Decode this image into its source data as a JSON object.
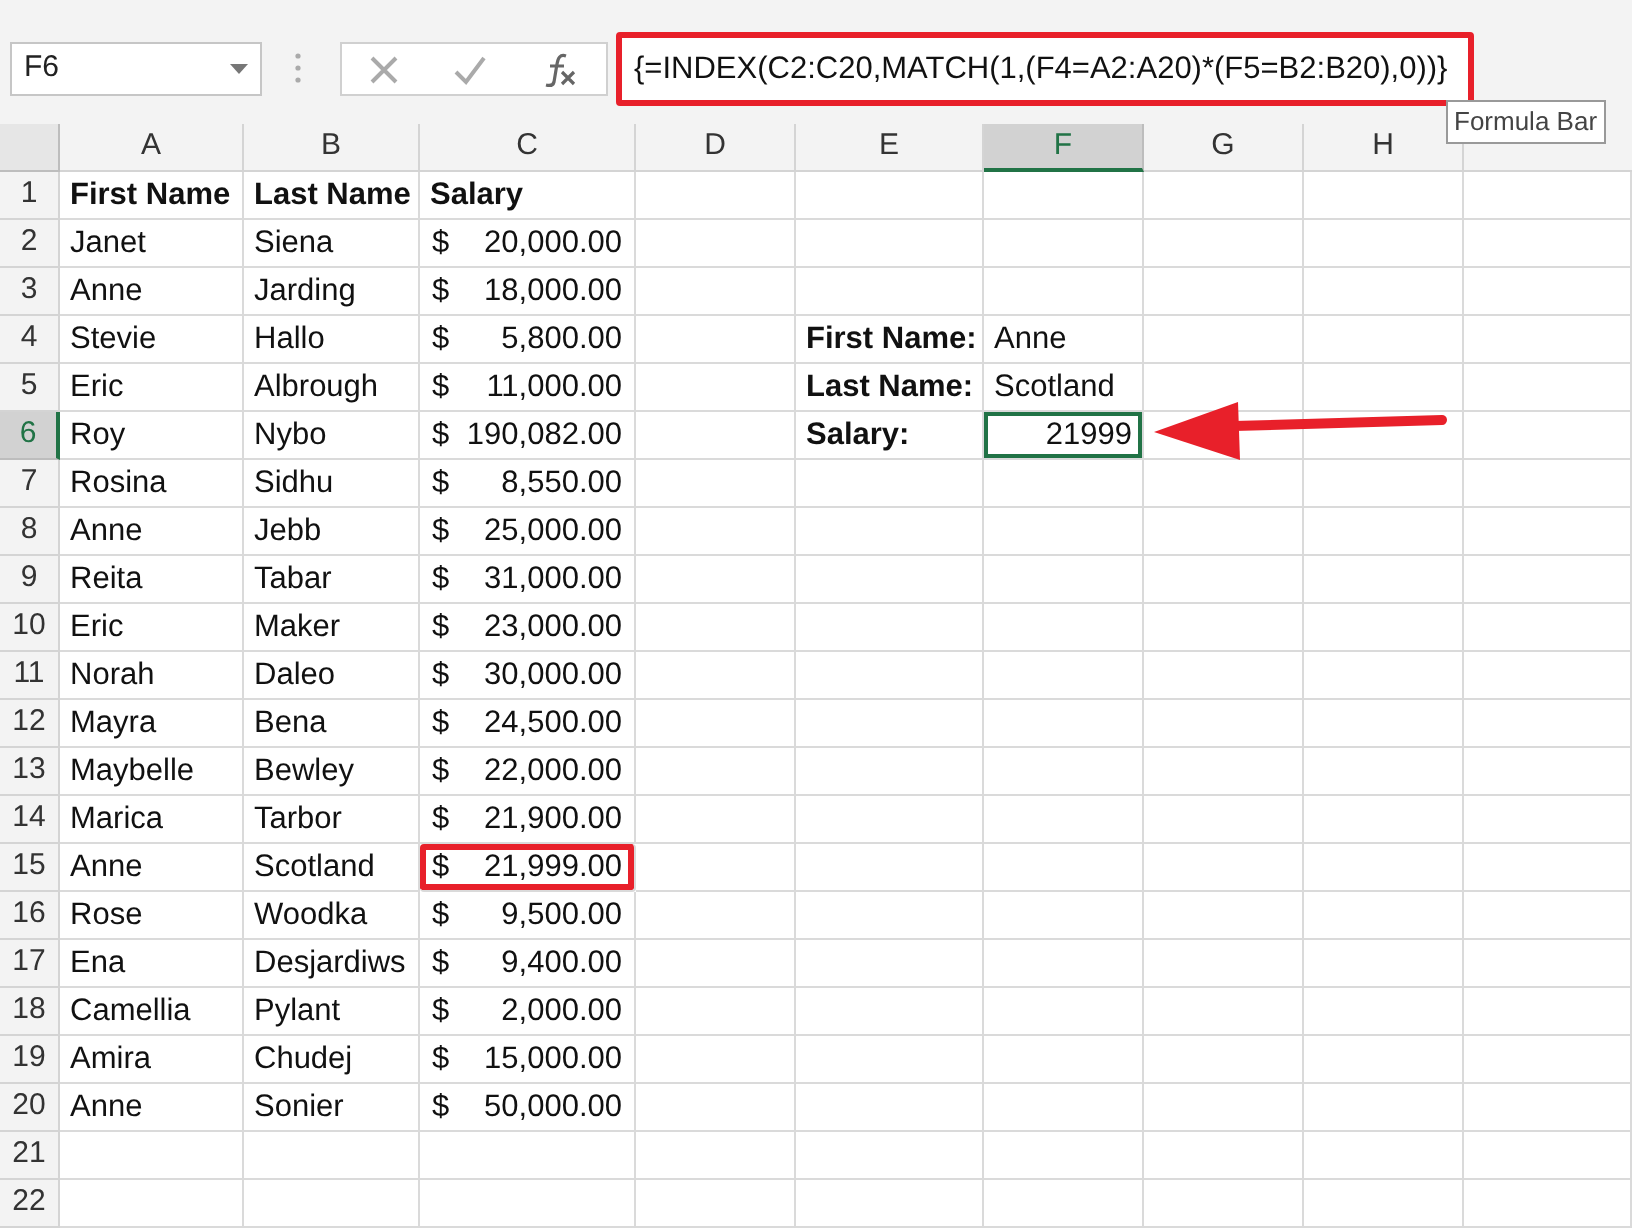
{
  "name_box": "F6",
  "formula_bar": {
    "text": "{=INDEX(C2:C20,MATCH(1,(F4=A2:A20)*(F5=B2:B20),0))}",
    "highlighted": true
  },
  "tooltip": "Formula Bar",
  "columns": [
    {
      "label": "A",
      "selected": false
    },
    {
      "label": "B",
      "selected": false
    },
    {
      "label": "C",
      "selected": false
    },
    {
      "label": "D",
      "selected": false
    },
    {
      "label": "E",
      "selected": false
    },
    {
      "label": "F",
      "selected": true
    },
    {
      "label": "G",
      "selected": false
    },
    {
      "label": "H",
      "selected": false
    }
  ],
  "rows": [
    {
      "number": "1",
      "selected": false,
      "kind": "header",
      "cells": [
        "First Name",
        "Last Name",
        "Salary"
      ]
    },
    {
      "number": "2",
      "selected": false,
      "kind": "data",
      "cells": [
        "Janet",
        "Siena",
        "$ 20,000.00"
      ],
      "highlighted": false
    },
    {
      "number": "3",
      "selected": false,
      "kind": "data",
      "cells": [
        "Anne",
        "Jarding",
        "$ 18,000.00"
      ],
      "highlighted": false
    },
    {
      "number": "4",
      "selected": false,
      "kind": "data",
      "cells": [
        "Stevie",
        "Hallo",
        "$ 5,800.00"
      ],
      "highlighted": false
    },
    {
      "number": "5",
      "selected": false,
      "kind": "data",
      "cells": [
        "Eric",
        "Albrough",
        "$ 11,000.00"
      ],
      "highlighted": false
    },
    {
      "number": "6",
      "selected": true,
      "kind": "data",
      "cells": [
        "Roy",
        "Nybo",
        "$ 190,082.00"
      ],
      "highlighted": false
    },
    {
      "number": "7",
      "selected": false,
      "kind": "data",
      "cells": [
        "Rosina",
        "Sidhu",
        "$ 8,550.00"
      ],
      "highlighted": false
    },
    {
      "number": "8",
      "selected": false,
      "kind": "data",
      "cells": [
        "Anne",
        "Jebb",
        "$ 25,000.00"
      ],
      "highlighted": false
    },
    {
      "number": "9",
      "selected": false,
      "kind": "data",
      "cells": [
        "Reita",
        "Tabar",
        "$ 31,000.00"
      ],
      "highlighted": false
    },
    {
      "number": "10",
      "selected": false,
      "kind": "data",
      "cells": [
        "Eric",
        "Maker",
        "$ 23,000.00"
      ],
      "highlighted": false
    },
    {
      "number": "11",
      "selected": false,
      "kind": "data",
      "cells": [
        "Norah",
        "Daleo",
        "$ 30,000.00"
      ],
      "highlighted": false
    },
    {
      "number": "12",
      "selected": false,
      "kind": "data",
      "cells": [
        "Mayra",
        "Bena",
        "$ 24,500.00"
      ],
      "highlighted": false
    },
    {
      "number": "13",
      "selected": false,
      "kind": "data",
      "cells": [
        "Maybelle",
        "Bewley",
        "$ 22,000.00"
      ],
      "highlighted": false
    },
    {
      "number": "14",
      "selected": false,
      "kind": "data",
      "cells": [
        "Marica",
        "Tarbor",
        "$ 21,900.00"
      ],
      "highlighted": false
    },
    {
      "number": "15",
      "selected": false,
      "kind": "data",
      "cells": [
        "Anne",
        "Scotland",
        "$ 21,999.00"
      ],
      "highlighted": true
    },
    {
      "number": "16",
      "selected": false,
      "kind": "data",
      "cells": [
        "Rose",
        "Woodka",
        "$ 9,500.00"
      ],
      "highlighted": false
    },
    {
      "number": "17",
      "selected": false,
      "kind": "data",
      "cells": [
        "Ena",
        "Desjardiws",
        "$ 9,400.00"
      ],
      "highlighted": false
    },
    {
      "number": "18",
      "selected": false,
      "kind": "data",
      "cells": [
        "Camellia",
        "Pylant",
        "$ 2,000.00"
      ],
      "highlighted": false
    },
    {
      "number": "19",
      "selected": false,
      "kind": "data",
      "cells": [
        "Amira",
        "Chudej",
        "$ 15,000.00"
      ],
      "highlighted": false
    },
    {
      "number": "20",
      "selected": false,
      "kind": "data",
      "cells": [
        "Anne",
        "Sonier",
        "$ 50,000.00"
      ],
      "highlighted": false
    },
    {
      "number": "21",
      "selected": false,
      "kind": "empty",
      "cells": []
    },
    {
      "number": "22",
      "selected": false,
      "kind": "empty",
      "cells": []
    }
  ],
  "lookup": [
    {
      "label": "First Name:",
      "value": "Anne",
      "selected": false,
      "kind": "text"
    },
    {
      "label": "Last Name:",
      "value": "Scotland",
      "selected": false,
      "kind": "text"
    },
    {
      "label": "Salary:",
      "value": "21999",
      "selected": true,
      "kind": "number"
    }
  ],
  "callout_arrow": true
}
